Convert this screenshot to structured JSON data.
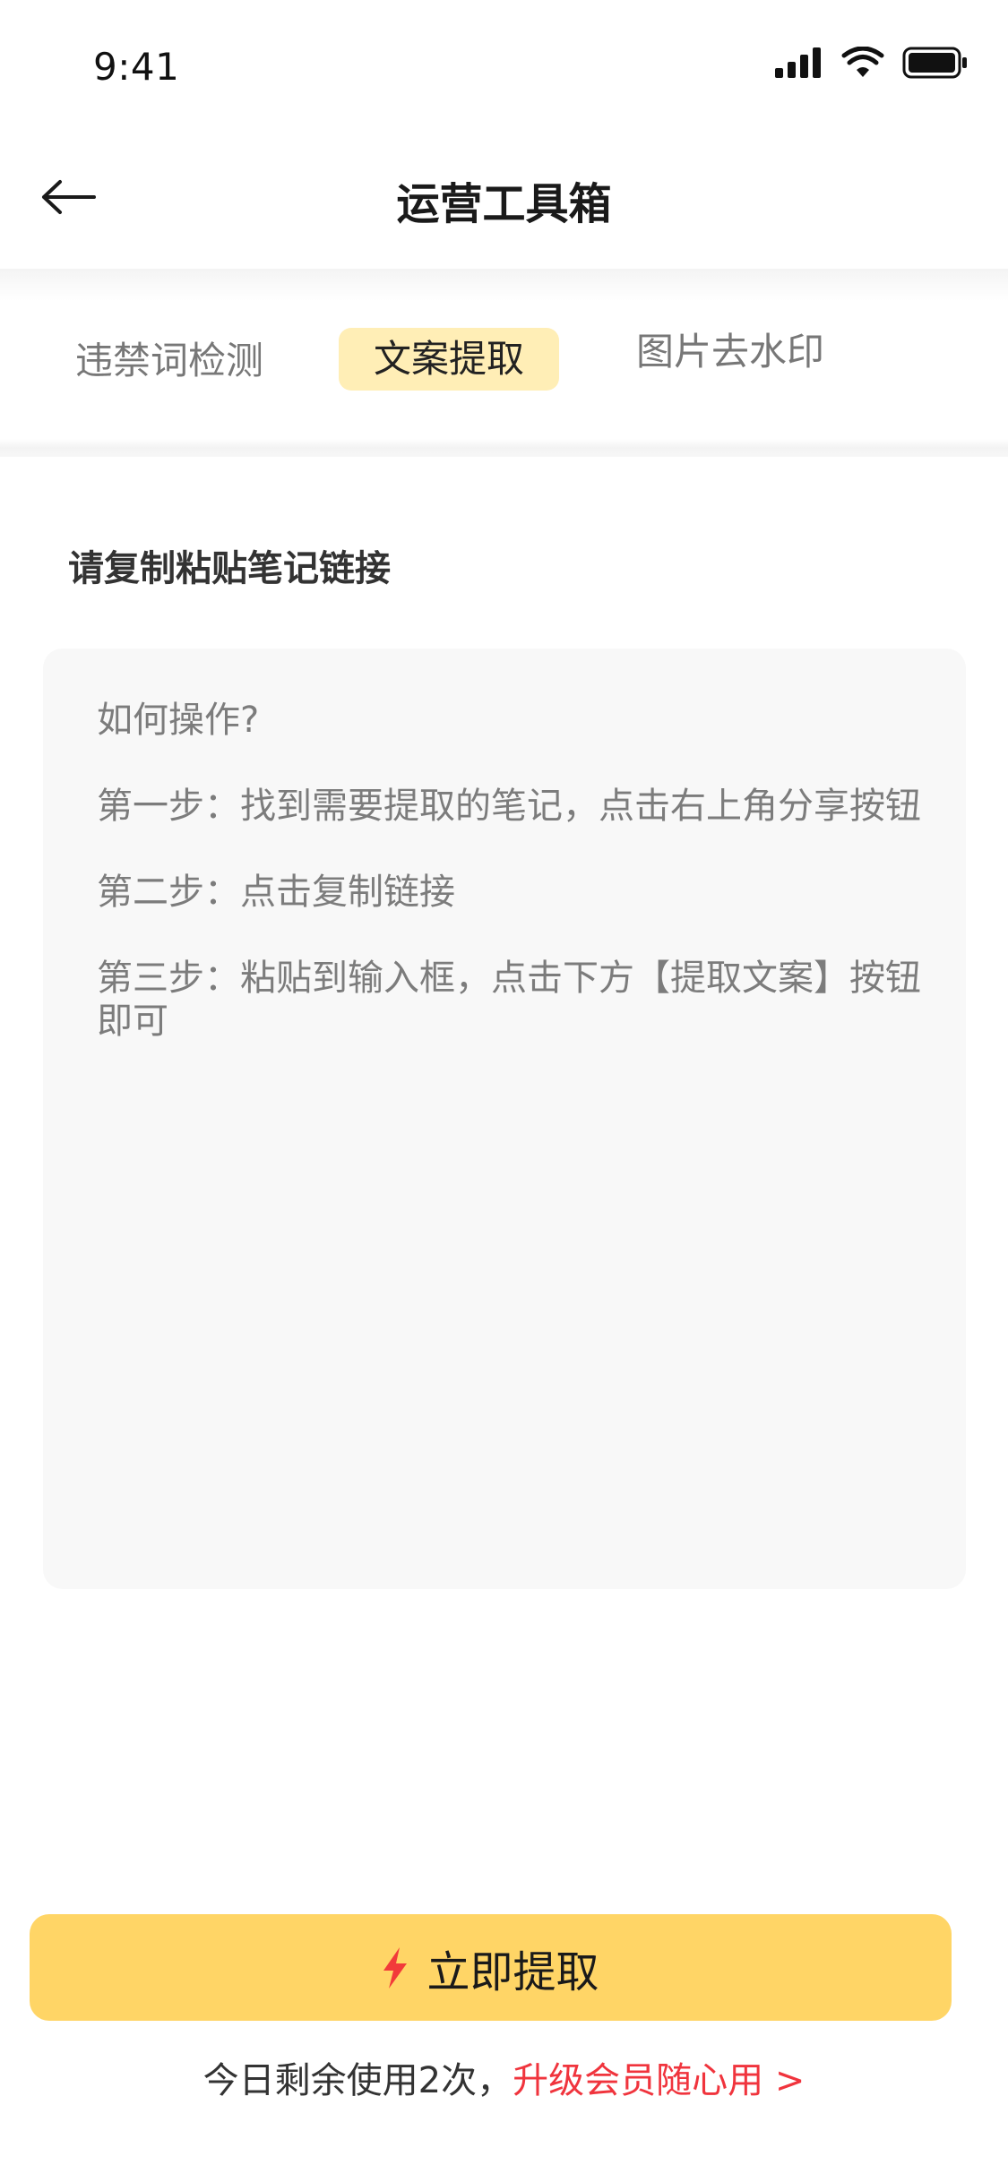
{
  "status_bar": {
    "time": "9:41",
    "icons": [
      "signal-icon",
      "wifi-icon",
      "battery-icon"
    ]
  },
  "header": {
    "title": "运营工具箱",
    "back_icon": "arrow-left-icon"
  },
  "tabs": [
    {
      "label": "违禁词检测",
      "active": false
    },
    {
      "label": "文案提取",
      "active": true
    },
    {
      "label": "图片去水印",
      "active": false
    }
  ],
  "form": {
    "label": "请复制粘贴笔记链接",
    "placeholder_lines": [
      "如何操作?",
      "第一步：找到需要提取的笔记，点击右上角分享按钮",
      "第二步：点击复制链接",
      "第三步：粘贴到输入框，点击下方【提取文案】按钮即可"
    ]
  },
  "action": {
    "icon": "lightning-icon",
    "label": "立即提取"
  },
  "footer": {
    "usage_text": "今日剩余使用2次，",
    "upgrade_text": "升级会员随心用 >"
  },
  "colors": {
    "accent": "#ffd566",
    "tab_active_bg": "#ffeeb6",
    "link_red": "#f0343d",
    "icon_red": "#f23a3a"
  }
}
